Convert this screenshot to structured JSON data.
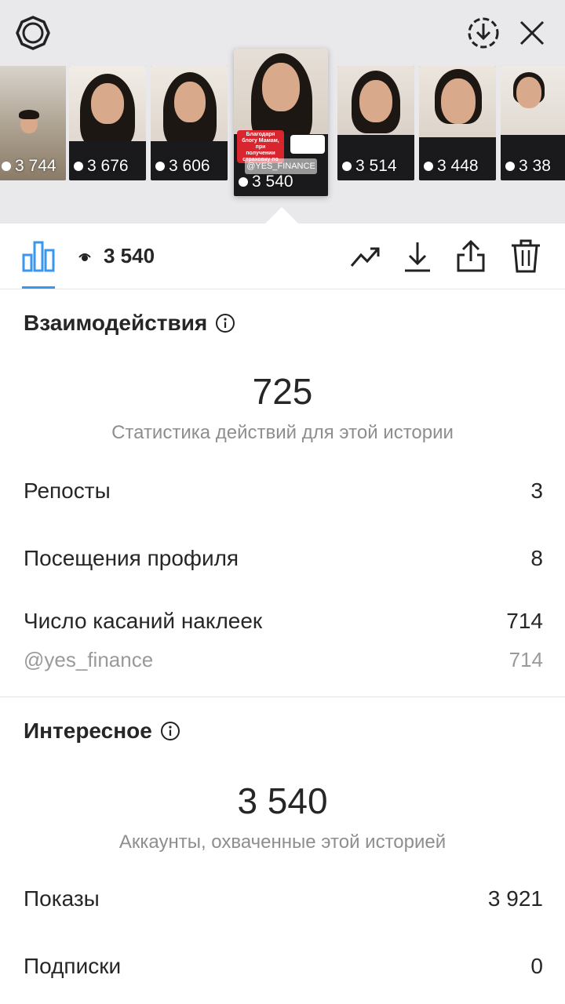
{
  "top_bar": {
    "settings_icon": "settings-gear-icon",
    "download_icon": "download-circle-icon",
    "close_icon": "close-icon"
  },
  "stories": [
    {
      "views": "3 744",
      "selected": false
    },
    {
      "views": "3 676",
      "selected": false
    },
    {
      "views": "3 606",
      "selected": false
    },
    {
      "views": "3 540",
      "selected": true,
      "sticker_text": "Благодаря блогу Мамам, при получении страховку по кредиту",
      "mention_sticker": "@YES_FINANCE"
    },
    {
      "views": "3 514",
      "selected": false
    },
    {
      "views": "3 448",
      "selected": false
    },
    {
      "views": "3 38",
      "selected": false
    }
  ],
  "toolbar": {
    "insights_icon": "bar-chart-icon",
    "eye_icon": "eye-icon",
    "views": "3 540",
    "actions": [
      {
        "icon": "trending-up-icon"
      },
      {
        "icon": "download-icon"
      },
      {
        "icon": "share-icon"
      },
      {
        "icon": "trash-icon"
      }
    ]
  },
  "interactions": {
    "title": "Взаимодействия",
    "total": "725",
    "total_label": "Статистика действий для этой истории",
    "rows": [
      {
        "label": "Репосты",
        "value": "3"
      },
      {
        "label": "Посещения профиля",
        "value": "8"
      },
      {
        "label": "Число касаний наклеек",
        "value": "714"
      }
    ],
    "sub_row": {
      "label": "@yes_finance",
      "value": "714"
    }
  },
  "discovery": {
    "title": "Интересное",
    "total": "3 540",
    "total_label": "Аккаунты, охваченные этой историей",
    "rows": [
      {
        "label": "Показы",
        "value": "3 921"
      },
      {
        "label": "Подписки",
        "value": "0"
      }
    ]
  },
  "colors": {
    "accent": "#3897f0",
    "top_background": "#e9e9ec",
    "secondary_text": "#8e8e8e"
  }
}
